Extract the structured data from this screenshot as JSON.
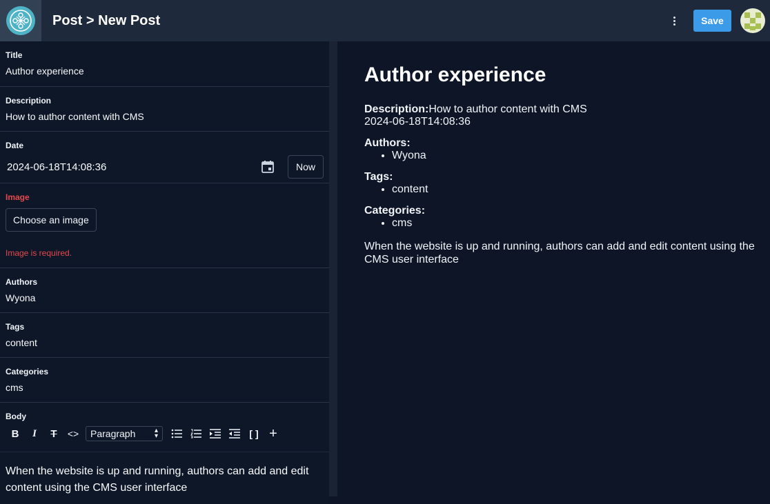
{
  "header": {
    "title": "Post > New Post",
    "save_label": "Save",
    "accent_color": "#3b9be8"
  },
  "form": {
    "title": {
      "label": "Title",
      "value": "Author experience"
    },
    "description": {
      "label": "Description",
      "value": "How to author content with CMS"
    },
    "date": {
      "label": "Date",
      "value": "2024-06-18T14:08:36",
      "now_label": "Now"
    },
    "image": {
      "label": "Image",
      "button_label": "Choose an image",
      "error": "Image is required.",
      "error_color": "#e5484d"
    },
    "authors": {
      "label": "Authors",
      "value": "Wyona"
    },
    "tags": {
      "label": "Tags",
      "value": "content"
    },
    "categories": {
      "label": "Categories",
      "value": "cms"
    },
    "body": {
      "label": "Body",
      "format_select": "Paragraph",
      "toolbar_icons": [
        "bold-icon",
        "italic-icon",
        "strikethrough-icon",
        "code-icon",
        "bulleted-list-icon",
        "numbered-list-icon",
        "indent-icon",
        "outdent-icon",
        "code-block-icon",
        "add-icon"
      ],
      "text": "When the website is up and running, authors can add and edit content using the CMS user interface"
    }
  },
  "preview": {
    "title": "Author experience",
    "description_label": "Description:",
    "description": "How to author content with CMS",
    "date": "2024-06-18T14:08:36",
    "authors_label": "Authors:",
    "authors": [
      "Wyona"
    ],
    "tags_label": "Tags:",
    "tags": [
      "content"
    ],
    "categories_label": "Categories:",
    "categories": [
      "cms"
    ],
    "body": "When the website is up and running, authors can add and edit content using the CMS user interface"
  }
}
